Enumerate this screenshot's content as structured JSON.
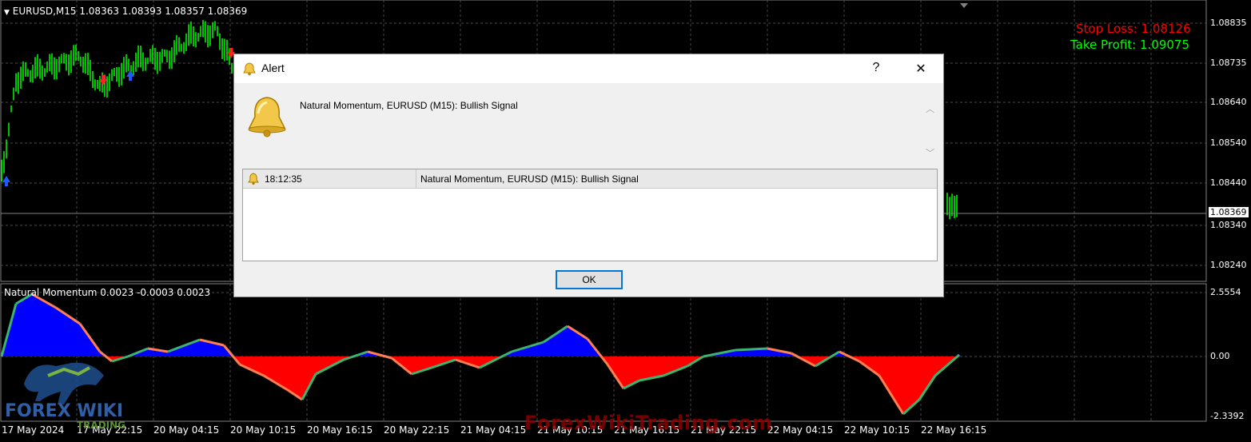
{
  "chart": {
    "header": "EURUSD,M15  1.08363 1.08393 1.08357 1.08369",
    "stop_loss": "Stop Loss: 1.08126",
    "take_profit": "Take Profit: 1.09075",
    "current_price": "1.08369",
    "price_axis": [
      "1.08835",
      "1.08735",
      "1.08640",
      "1.08540",
      "1.08440",
      "1.08340",
      "1.08240"
    ],
    "indicator_header": "Natural Momentum 0.0023 -0.0003 0.0023",
    "indicator_axis": [
      "2.5554",
      "0.00",
      "-2.3392"
    ],
    "time_axis": [
      "17 May 2024",
      "17 May 22:15",
      "20 May 04:15",
      "20 May 10:15",
      "20 May 16:15",
      "20 May 22:15",
      "21 May 04:15",
      "21 May 10:15",
      "21 May 16:15",
      "21 May 22:15",
      "22 May 04:15",
      "22 May 10:15",
      "22 May 16:15"
    ],
    "colors": {
      "bull": "#00ff00",
      "bear": "#ff0000",
      "grid": "#5a5a5a",
      "momentum_pos": "#0000ff",
      "momentum_neg": "#ff0000",
      "momentum_line_up": "#3cb371",
      "momentum_line_down": "#ff7f50"
    }
  },
  "alert": {
    "title": "Alert",
    "help": "?",
    "close": "✕",
    "message": "Natural Momentum, EURUSD (M15): Bullish Signal",
    "rows": [
      {
        "time": "18:12:35",
        "text": "Natural Momentum, EURUSD (M15): Bullish Signal"
      }
    ],
    "ok": "OK",
    "icon": "bell-icon"
  },
  "watermark": "ForexWikiTrading.com",
  "logo": {
    "text": "FOREX WIKI",
    "sub": "TRADING"
  }
}
